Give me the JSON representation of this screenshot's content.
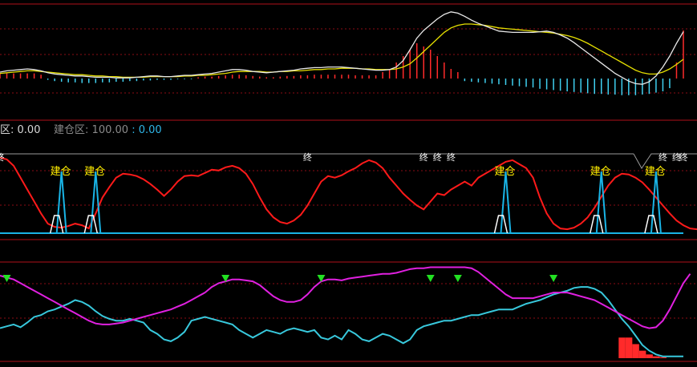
{
  "legend": {
    "series1_label_fragment": "区",
    "series1_value": "0.00",
    "series2_label": "建仓区",
    "series2_value_a": "100.00",
    "series2_value_b": "0.00"
  },
  "colors": {
    "background": "#000000",
    "panel_border": "#b0101a",
    "grid_red": "#8c0c14",
    "macd_white": "#e8e8e8",
    "macd_yellow": "#e6e000",
    "bar_red": "#ff2a2a",
    "bar_cyan": "#3fd0f0",
    "red_line": "#ff1a1a",
    "cyan_line": "#19b4e6",
    "white_line": "#ffffff",
    "gray_line": "#9a9a9a",
    "label_yellow": "#ffee00",
    "magenta": "#e020e0",
    "teal": "#38c8dc",
    "green_marker": "#22e022"
  },
  "chart_data": [
    {
      "type": "line",
      "x_count": 101,
      "ylim": [
        -0.6,
        1.1
      ],
      "series": [
        {
          "values": [
            0.1,
            0.12,
            0.13,
            0.14,
            0.15,
            0.14,
            0.12,
            0.09,
            0.07,
            0.06,
            0.05,
            0.04,
            0.04,
            0.03,
            0.02,
            0.02,
            0.02,
            0.01,
            0.01,
            0.01,
            0.02,
            0.03,
            0.04,
            0.04,
            0.03,
            0.03,
            0.04,
            0.05,
            0.05,
            0.06,
            0.07,
            0.08,
            0.1,
            0.12,
            0.14,
            0.14,
            0.13,
            0.11,
            0.1,
            0.09,
            0.1,
            0.11,
            0.12,
            0.13,
            0.15,
            0.16,
            0.17,
            0.17,
            0.18,
            0.18,
            0.18,
            0.17,
            0.16,
            0.15,
            0.14,
            0.13,
            0.13,
            0.14,
            0.18,
            0.28,
            0.45,
            0.63,
            0.75,
            0.84,
            0.93,
            1.0,
            1.04,
            1.02,
            0.97,
            0.91,
            0.86,
            0.82,
            0.78,
            0.74,
            0.73,
            0.72,
            0.72,
            0.72,
            0.72,
            0.73,
            0.74,
            0.72,
            0.68,
            0.63,
            0.56,
            0.48,
            0.4,
            0.32,
            0.24,
            0.16,
            0.08,
            0.02,
            -0.04,
            -0.08,
            -0.09,
            -0.05,
            0.04,
            0.18,
            0.35,
            0.55,
            0.73
          ]
        },
        {
          "values": [
            0.08,
            0.09,
            0.1,
            0.11,
            0.12,
            0.12,
            0.11,
            0.1,
            0.09,
            0.08,
            0.07,
            0.06,
            0.06,
            0.05,
            0.04,
            0.04,
            0.03,
            0.03,
            0.02,
            0.02,
            0.02,
            0.02,
            0.03,
            0.03,
            0.03,
            0.03,
            0.03,
            0.04,
            0.04,
            0.05,
            0.05,
            0.06,
            0.07,
            0.08,
            0.1,
            0.11,
            0.11,
            0.11,
            0.11,
            0.1,
            0.1,
            0.11,
            0.11,
            0.12,
            0.12,
            0.13,
            0.14,
            0.14,
            0.15,
            0.15,
            0.16,
            0.16,
            0.16,
            0.15,
            0.15,
            0.14,
            0.14,
            0.14,
            0.15,
            0.18,
            0.23,
            0.32,
            0.42,
            0.52,
            0.62,
            0.72,
            0.79,
            0.83,
            0.85,
            0.85,
            0.84,
            0.83,
            0.81,
            0.79,
            0.78,
            0.77,
            0.76,
            0.75,
            0.74,
            0.73,
            0.72,
            0.71,
            0.69,
            0.67,
            0.64,
            0.6,
            0.55,
            0.49,
            0.43,
            0.37,
            0.31,
            0.25,
            0.19,
            0.13,
            0.09,
            0.07,
            0.07,
            0.1,
            0.15,
            0.22,
            0.3
          ]
        },
        {
          "type": "bar",
          "values": [
            0.08,
            0.08,
            0.08,
            0.08,
            0.08,
            0.08,
            0.06,
            -0.02,
            -0.04,
            -0.05,
            -0.06,
            -0.06,
            -0.07,
            -0.07,
            -0.07,
            -0.06,
            -0.06,
            -0.05,
            -0.05,
            -0.04,
            -0.04,
            -0.03,
            -0.03,
            -0.02,
            -0.02,
            -0.02,
            -0.01,
            -0.01,
            -0.01,
            0.02,
            0.03,
            0.03,
            0.04,
            0.05,
            0.06,
            0.06,
            0.05,
            0.04,
            0.03,
            0.02,
            0.02,
            0.03,
            0.04,
            0.04,
            0.05,
            0.05,
            0.06,
            0.06,
            0.06,
            0.06,
            0.06,
            0.06,
            0.05,
            0.05,
            0.05,
            0.05,
            0.1,
            0.15,
            0.25,
            0.35,
            0.45,
            0.55,
            0.5,
            0.45,
            0.35,
            0.25,
            0.15,
            0.1,
            -0.04,
            -0.05,
            -0.06,
            -0.07,
            -0.08,
            -0.09,
            -0.1,
            -0.11,
            -0.12,
            -0.13,
            -0.14,
            -0.16,
            -0.17,
            -0.18,
            -0.19,
            -0.2,
            -0.21,
            -0.22,
            -0.23,
            -0.24,
            -0.24,
            -0.25,
            -0.25,
            -0.26,
            -0.26,
            -0.26,
            -0.25,
            -0.24,
            -0.22,
            -0.2,
            -0.15,
            0.25,
            0.75
          ]
        }
      ]
    },
    {
      "type": "line",
      "x_count": 101,
      "ylim": [
        0,
        100
      ],
      "series": [
        {
          "values": [
            95,
            93,
            85,
            70,
            55,
            40,
            25,
            12,
            8,
            7,
            9,
            12,
            10,
            6,
            25,
            45,
            58,
            70,
            75,
            74,
            72,
            68,
            62,
            55,
            47,
            55,
            65,
            72,
            73,
            72,
            76,
            80,
            79,
            83,
            85,
            82,
            75,
            62,
            45,
            30,
            20,
            14,
            12,
            16,
            23,
            35,
            50,
            65,
            72,
            70,
            73,
            78,
            82,
            88,
            92,
            89,
            82,
            70,
            60,
            50,
            42,
            35,
            30,
            40,
            50,
            48,
            55,
            60,
            65,
            60,
            70,
            75,
            80,
            85,
            90,
            92,
            87,
            82,
            70,
            45,
            25,
            12,
            6,
            5,
            7,
            12,
            20,
            32,
            46,
            60,
            70,
            75,
            74,
            70,
            64,
            55,
            45,
            35,
            25,
            16,
            10,
            6,
            5,
            8,
            15,
            30,
            50,
            68,
            80,
            88,
            92,
            94,
            95,
            96,
            97,
            98
          ]
        },
        {
          "values": [
            0,
            0,
            0,
            0,
            0,
            0,
            0,
            0,
            0,
            0,
            0,
            0,
            0,
            0,
            0,
            0,
            0,
            0,
            0,
            0,
            0,
            0,
            0,
            0,
            0,
            0,
            0,
            0,
            0,
            0,
            0,
            0,
            0,
            0,
            0,
            0,
            0,
            0,
            0,
            0,
            0,
            0,
            0,
            0,
            0,
            0,
            0,
            0,
            0,
            0,
            0,
            0,
            0,
            0,
            0,
            0,
            0,
            0,
            0,
            0,
            0,
            0,
            0,
            0,
            0,
            0,
            0,
            0,
            0,
            0,
            0,
            0,
            0,
            0,
            0,
            0,
            0,
            0,
            0,
            0,
            0,
            0,
            0,
            0,
            0,
            0,
            0,
            0,
            0,
            0,
            0,
            0,
            0,
            0,
            0,
            0,
            0,
            0,
            0,
            0
          ]
        }
      ]
    },
    {
      "type": "line",
      "x_count": 101,
      "ylim": [
        0,
        100
      ],
      "series": [
        {
          "values": [
            88,
            86,
            84,
            80,
            76,
            72,
            68,
            64,
            60,
            56,
            52,
            48,
            44,
            40,
            37,
            36,
            36,
            37,
            38,
            40,
            42,
            44,
            46,
            48,
            50,
            52,
            55,
            58,
            62,
            66,
            70,
            76,
            80,
            82,
            84,
            84,
            83,
            82,
            78,
            72,
            66,
            62,
            60,
            60,
            62,
            68,
            76,
            82,
            84,
            84,
            83,
            85,
            86,
            87,
            88,
            89,
            90,
            90,
            91,
            93,
            95,
            96,
            96,
            97,
            97,
            97,
            97,
            97,
            97,
            96,
            92,
            86,
            80,
            74,
            68,
            64,
            64,
            64,
            64,
            66,
            68,
            70,
            70,
            70,
            68,
            66,
            64,
            62,
            58,
            54,
            50,
            46,
            42,
            38,
            34,
            32,
            33,
            40,
            52,
            66,
            80,
            90
          ]
        },
        {
          "values": [
            32,
            34,
            36,
            33,
            38,
            44,
            46,
            50,
            52,
            55,
            58,
            62,
            60,
            56,
            50,
            45,
            42,
            40,
            40,
            42,
            40,
            38,
            30,
            26,
            20,
            18,
            22,
            28,
            40,
            42,
            44,
            42,
            40,
            38,
            36,
            30,
            26,
            22,
            26,
            30,
            28,
            26,
            30,
            32,
            30,
            28,
            30,
            22,
            20,
            24,
            20,
            30,
            26,
            20,
            18,
            22,
            26,
            24,
            20,
            16,
            20,
            30,
            34,
            36,
            38,
            40,
            40,
            42,
            44,
            46,
            46,
            48,
            50,
            52,
            52,
            52,
            55,
            58,
            60,
            62,
            65,
            68,
            70,
            72,
            75,
            76,
            76,
            74,
            70,
            62,
            52,
            42,
            34,
            24,
            14,
            8,
            4,
            2,
            2,
            2,
            2
          ]
        },
        {
          "type": "bar",
          "values": [
            0,
            0,
            0,
            0,
            0,
            0,
            0,
            0,
            0,
            0,
            0,
            0,
            0,
            0,
            0,
            0,
            0,
            0,
            0,
            0,
            0,
            0,
            0,
            0,
            0,
            0,
            0,
            0,
            0,
            0,
            0,
            0,
            0,
            0,
            0,
            0,
            0,
            0,
            0,
            0,
            0,
            0,
            0,
            0,
            0,
            0,
            0,
            0,
            0,
            0,
            0,
            0,
            0,
            0,
            0,
            0,
            0,
            0,
            0,
            0,
            0,
            0,
            0,
            0,
            0,
            0,
            0,
            0,
            0,
            0,
            0,
            0,
            0,
            0,
            0,
            0,
            0,
            0,
            0,
            0,
            0,
            0,
            0,
            0,
            0,
            0,
            0,
            0,
            0,
            0,
            0,
            22,
            22,
            15,
            8,
            4,
            2,
            1,
            0,
            0,
            0
          ]
        }
      ]
    }
  ],
  "annotations": {
    "jiancang_label": "建仓",
    "zhong_label": "终",
    "jiancang_positions": [
      9,
      14,
      74,
      88,
      96
    ],
    "zhong_positions": [
      0,
      45,
      62,
      64,
      66,
      97,
      99,
      100
    ],
    "green_markers": [
      1,
      33,
      47,
      63,
      67,
      81
    ]
  }
}
